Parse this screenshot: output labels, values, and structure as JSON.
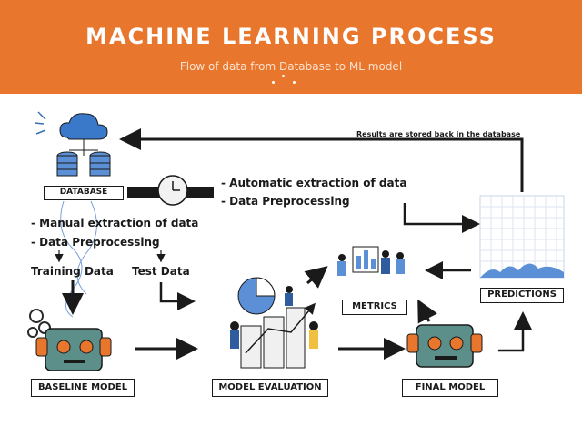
{
  "header": {
    "title": "MACHINE LEARNING PROCESS",
    "subtitle": "Flow of data from Database to ML model"
  },
  "nodes": {
    "database": "DATABASE",
    "baseline_model": "BASELINE MODEL",
    "model_evaluation": "MODEL EVALUATION",
    "final_model": "FINAL MODEL",
    "metrics": "METRICS",
    "predictions": "PREDICTIONS"
  },
  "labels": {
    "feedback": "Results are stored back in the database",
    "auto_extraction": "- Automatic extraction of data",
    "auto_preprocessing": "- Data Preprocessing",
    "manual_extraction": "- Manual extraction of data",
    "manual_preprocessing": "- Data Preprocessing",
    "training_data": "Training Data",
    "test_data": "Test Data"
  },
  "colors": {
    "header_bg": "#e8762d",
    "accent_blue": "#5b8fd6",
    "robot_face": "#5c8f8a",
    "robot_ears": "#e8762d"
  },
  "icons": [
    "cloud-database-icon",
    "clock-icon",
    "gears-icon",
    "robot-icon",
    "team-chart-icon",
    "predictions-chart-icon"
  ]
}
